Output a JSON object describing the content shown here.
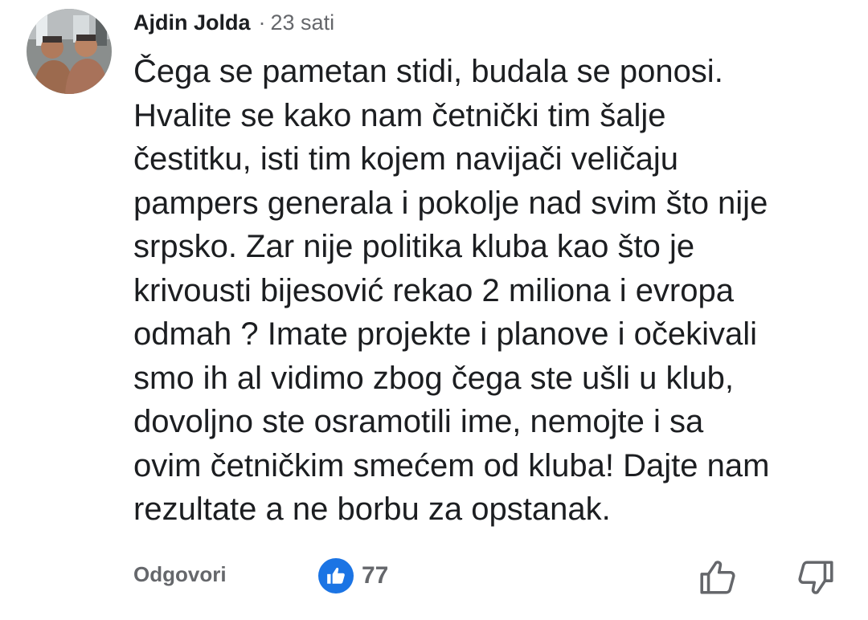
{
  "comment": {
    "author": "Ajdin Jolda",
    "separator": "·",
    "time": "23 sati",
    "text": "Čega se pametan stidi, budala se ponosi.\nHvalite se kako nam četnički tim šalje\nčestitku, isti tim kojem navijači veličaju\npampers generala i pokolje nad svim što nije\nsrpsko. Zar nije politika kluba kao što je\nkrivousti bijesović rekao 2 miliona i evropa\nodmah ? Imate projekte i planove i očekivali\nsmo ih al vidimo zbog čega ste ušli u klub,\ndovoljno ste osramotili ime, nemojte i sa\novim četničkim smećem od kluba! Dajte nam\nrezultate a ne borbu za opstanak."
  },
  "actions": {
    "reply_label": "Odgovori",
    "like_count": "77",
    "like_icon": "thumbs-up-icon",
    "upvote_icon": "thumbs-up-outline-icon",
    "downvote_icon": "thumbs-down-outline-icon"
  },
  "colors": {
    "text": "#1c1e21",
    "secondary": "#65676b",
    "like_blue": "#1b74e4"
  }
}
